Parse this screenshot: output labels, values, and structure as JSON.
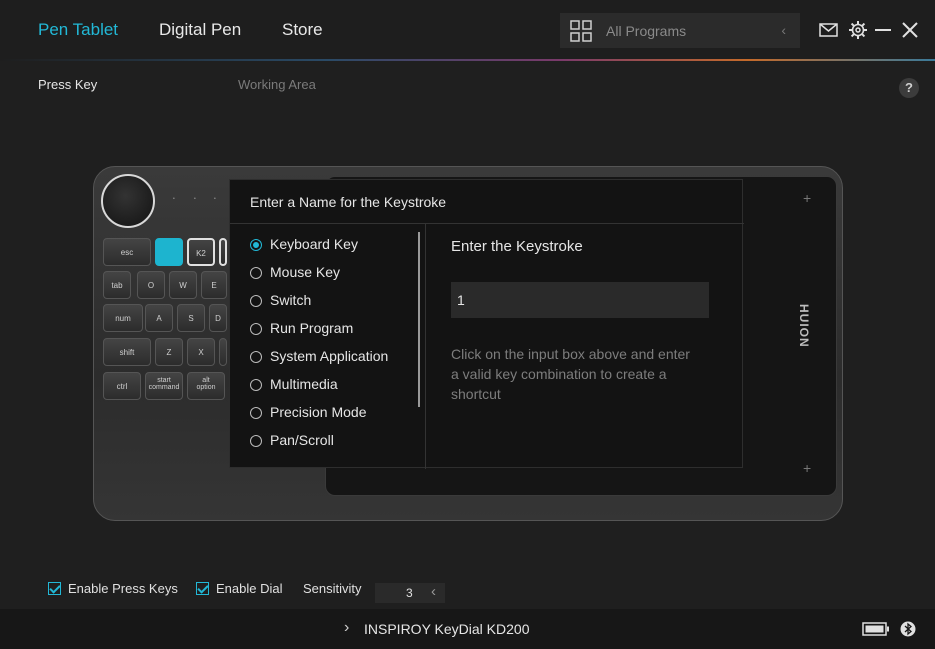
{
  "header": {
    "tabs": [
      {
        "label": "Pen Tablet",
        "active": true
      },
      {
        "label": "Digital Pen",
        "active": false
      },
      {
        "label": "Store",
        "active": false
      }
    ],
    "program_selector_placeholder": "All Programs"
  },
  "subtabs": [
    "Press Key",
    "Working Area"
  ],
  "help_label": "?",
  "device": {
    "brand": "HUION",
    "keys": {
      "esc": "esc",
      "tab": "tab",
      "num": "num",
      "shift": "shift",
      "ctrl": "ctrl",
      "start": "start\ncommand",
      "alt": "alt\noption",
      "k2": "K2",
      "o": "O",
      "w": "W",
      "e": "E",
      "a": "A",
      "s": "S",
      "d": "D",
      "z": "Z",
      "x": "X"
    }
  },
  "dialog": {
    "title": "Enter a Name for the Keystroke",
    "options": [
      {
        "label": "Keyboard Key",
        "selected": true
      },
      {
        "label": "Mouse Key",
        "selected": false
      },
      {
        "label": "Switch",
        "selected": false
      },
      {
        "label": "Run Program",
        "selected": false
      },
      {
        "label": "System Application",
        "selected": false
      },
      {
        "label": "Multimedia",
        "selected": false
      },
      {
        "label": "Precision Mode",
        "selected": false
      },
      {
        "label": "Pan/Scroll",
        "selected": false
      }
    ],
    "keystroke_title": "Enter the Keystroke",
    "keystroke_value": "1",
    "keystroke_help": "Click on the input box above and enter a valid key combination to create a shortcut"
  },
  "controls": {
    "enable_press_keys": "Enable Press Keys",
    "enable_dial": "Enable Dial",
    "sensitivity_label": "Sensitivity",
    "sensitivity_value": "3"
  },
  "status": {
    "device_name": "INSPIROY KeyDial KD200"
  },
  "colors": {
    "accent": "#22b8d6"
  }
}
